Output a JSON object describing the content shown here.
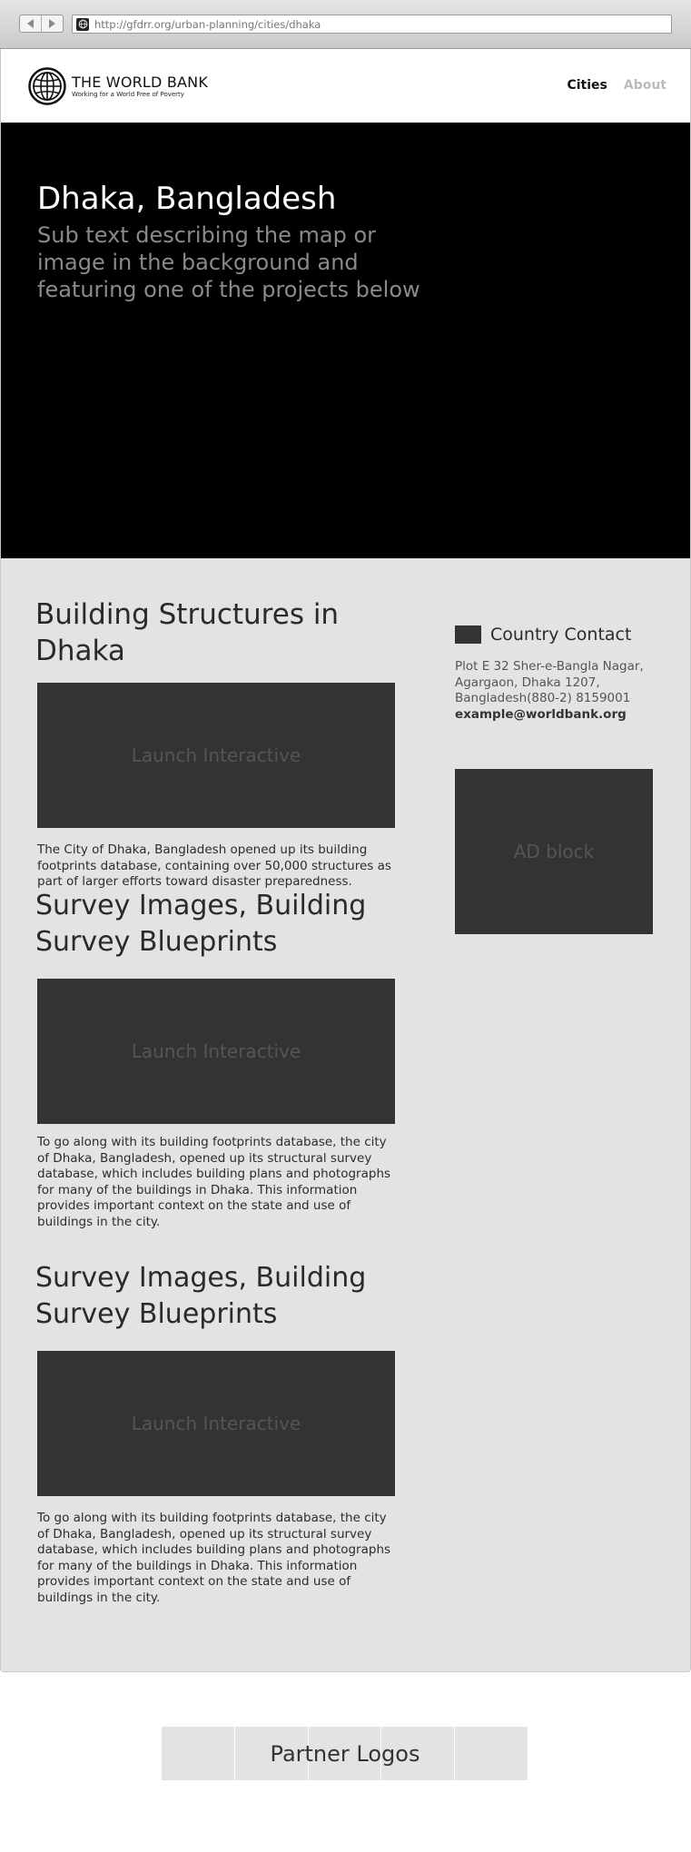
{
  "browser": {
    "url": "http://gfdrr.org/urban-planning/cities/dhaka"
  },
  "header": {
    "logo_title": "THE WORLD BANK",
    "logo_tagline": "Working for a World Free of Poverty",
    "nav": [
      {
        "label": "Cities",
        "active": true
      },
      {
        "label": "About",
        "active": false
      }
    ]
  },
  "hero": {
    "title": "Dhaka, Bangladesh",
    "subtitle": "Sub text describing the map or image in the background and featuring one of the projects below"
  },
  "sections": [
    {
      "title": "Building Structures in Dhaka",
      "media_label": "Launch Interactive",
      "text": "The City of Dhaka, Bangladesh opened up its building footprints database, containing over 50,000 structures as part of larger efforts toward disaster preparedness."
    },
    {
      "title": "Survey Images, Building Survey Blueprints",
      "media_label": "Launch Interactive",
      "text": "To go along with its building footprints database, the city of Dhaka, Bangladesh, opened up its structural survey database, which includes building plans and photographs for many of the buildings in Dhaka. This information provides important context on the state and use of buildings in the city."
    },
    {
      "title": "Survey Images, Building Survey Blueprints",
      "media_label": "Launch Interactive",
      "text": "To go along with its building footprints database, the city of Dhaka, Bangladesh, opened up its structural survey database, which includes building plans and photographs for many of the buildings in Dhaka. This information provides important context on the state and use of buildings in the city."
    }
  ],
  "sidebar": {
    "contact_title": "Country Contact",
    "address_line1": "Plot E 32 Sher-e-Bangla Nagar,",
    "address_line2": "Agargaon, Dhaka 1207,",
    "address_line3": "Bangladesh(880-2) 8159001",
    "email": "example@worldbank.org",
    "ad_label": "AD block"
  },
  "footer": {
    "partners_label": "Partner Logos"
  },
  "colors": {
    "hero_bg": "#000000",
    "main_bg": "#e3e3e3",
    "placeholder_bg": "#333333",
    "nav_active": "#111111",
    "nav_inactive": "#bbbbbb"
  }
}
